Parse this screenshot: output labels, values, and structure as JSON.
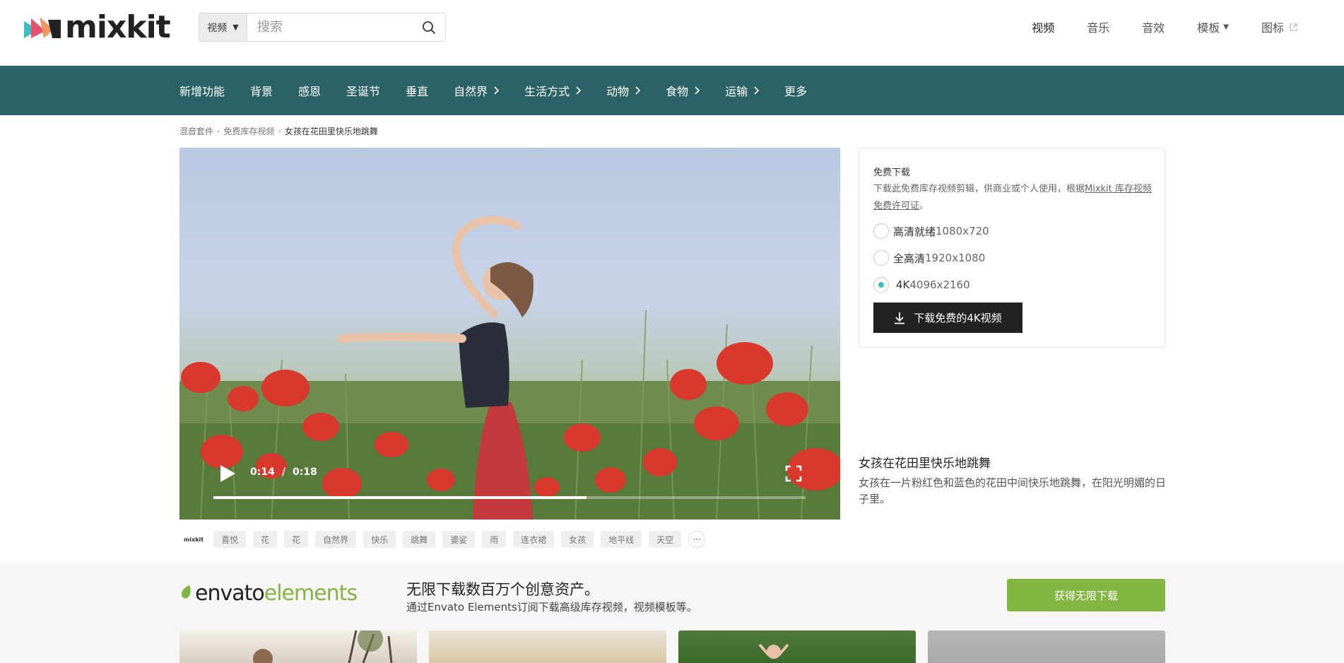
{
  "header": {
    "logo_text": "mixkit",
    "search": {
      "type_label": "视频",
      "placeholder": "搜索"
    },
    "nav": [
      {
        "label": "视频",
        "active": true
      },
      {
        "label": "音乐"
      },
      {
        "label": "音效"
      },
      {
        "label": "模板",
        "has_dropdown": true
      },
      {
        "label": "图标",
        "external": true
      }
    ]
  },
  "categories": [
    {
      "label": "新增功能"
    },
    {
      "label": "背景"
    },
    {
      "label": "感恩"
    },
    {
      "label": "圣诞节"
    },
    {
      "label": "垂直"
    },
    {
      "label": "自然界",
      "has_submenu": true
    },
    {
      "label": "生活方式",
      "has_submenu": true
    },
    {
      "label": "动物",
      "has_submenu": true
    },
    {
      "label": "食物",
      "has_submenu": true
    },
    {
      "label": "运输",
      "has_submenu": true
    },
    {
      "label": "更多"
    }
  ],
  "breadcrumb": [
    "混音套件",
    "免费库存视频",
    "女孩在花田里快乐地跳舞"
  ],
  "player": {
    "current_time": "0:14",
    "separator": "/",
    "duration": "0:18",
    "progress_fraction": 0.63
  },
  "tags": {
    "source_label": "mixkit",
    "items": [
      "喜悦",
      "花",
      "花",
      "自然界",
      "快乐",
      "跳舞",
      "婆娑",
      "雨",
      "连衣裙",
      "女孩",
      "地平线",
      "天空"
    ],
    "more_label": "···"
  },
  "download": {
    "title": "免费下载",
    "description_prefix": "下载此免费库存视频剪辑，供商业或个人使用，根据",
    "license_link": "Mixkit 库存视频免费许可证",
    "description_suffix": "。",
    "options": [
      {
        "label": "高清就绪",
        "resolution": "1080x720",
        "selected": false
      },
      {
        "label": "全高清",
        "resolution": "1920x1080",
        "selected": false
      },
      {
        "label": "4K ",
        "resolution": "4096x2160",
        "selected": true
      }
    ],
    "button_label": "下载免费的4K视频"
  },
  "video_info": {
    "title": "女孩在花田里快乐地跳舞",
    "description": "女孩在一片粉红色和蓝色的花田中间快乐地跳舞，在阳光明媚的日子里。"
  },
  "promo": {
    "logo_envato": "envato",
    "logo_elements": "elements",
    "headline": "无限下载数百万个创意资产。",
    "subline": "通过Envato Elements订阅下载高级库存视频，视频模板等。",
    "button_label": "获得无限下载"
  },
  "colors": {
    "category_bar": "#2b6266",
    "radio_accent": "#3ebdc0",
    "promo_green": "#82b541",
    "download_button": "#222222"
  }
}
